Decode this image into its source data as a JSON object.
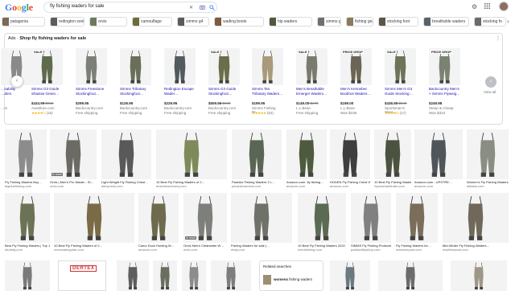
{
  "logo": {
    "letters": [
      "G",
      "o",
      "o",
      "g",
      "l",
      "e"
    ],
    "colors": [
      "#4285f4",
      "#ea4335",
      "#fbbc05",
      "#4285f4",
      "#34a853",
      "#ea4335"
    ]
  },
  "search": {
    "query": "fly fishing waders for sale",
    "close_icon": "close-icon",
    "camera_icon": "camera-icon",
    "search_icon": "search-icon"
  },
  "header_icons": [
    "gear-icon",
    "apps-grid-icon"
  ],
  "chips": [
    {
      "label": "patagonia",
      "color": "#7a6a55"
    },
    {
      "label": "redington sonic",
      "color": "#5c5c5c"
    },
    {
      "label": "orvis",
      "color": "#6b7b5a"
    },
    {
      "label": "camouflage",
      "color": "#6d6a3c"
    },
    {
      "label": "simms g4",
      "color": "#5a5a5a"
    },
    {
      "label": "wading boots",
      "color": "#7b5a3d"
    },
    {
      "label": "hip waders",
      "color": "#4e5a3a"
    },
    {
      "label": "simms g3",
      "color": "#6e6e6e"
    },
    {
      "label": "fishing gear",
      "color": "#8a7b5c"
    },
    {
      "label": "stocking foot",
      "color": "#5d5448"
    },
    {
      "label": "breathable waders",
      "color": "#57636b"
    },
    {
      "label": "stocking fo",
      "color": "#6a6a6a"
    }
  ],
  "ads": {
    "prefix": "Ads · ",
    "title": "Shop fly fishing waders for sale",
    "more_icon": "more-vert-icon",
    "view_all": "View all",
    "products": [
      {
        "badge": "",
        "name": "…sability\n…ders",
        "price": "",
        "old": "",
        "store": "…m",
        "rating": "",
        "reviews": "",
        "color": "#8a8a8a"
      },
      {
        "badge": "SALE",
        "name": "Simms G3 Guide\nShadow Green…",
        "price": "$434.99",
        "old": "$550",
        "store": "Avantlure.com",
        "rating": "★★★★½",
        "reviews": "(16)",
        "color": "#5e6b4d"
      },
      {
        "badge": "",
        "name": "Simms Freestone\nStockingfoot…",
        "price": "$299.95",
        "old": "",
        "store": "Backcountry.com",
        "rating": "",
        "reviews": "Free shipping",
        "color": "#7c7f78"
      },
      {
        "badge": "",
        "name": "Simms Tributary\nStockingfoot…",
        "price": "$126.95",
        "old": "",
        "store": "Backcountry.com",
        "rating": "",
        "reviews": "Free shipping",
        "color": "#6a6f5a"
      },
      {
        "badge": "",
        "name": "Redington Escape\nWader…",
        "price": "$229.95",
        "old": "",
        "store": "Backcountry.com",
        "rating": "",
        "reviews": "Free shipping",
        "color": "#535b5e"
      },
      {
        "badge": "SALE",
        "name": "Simms G3 Guide\nStockingfoot…",
        "price": "$509.96",
        "old": "$600",
        "store": "Backcountry.com",
        "rating": "",
        "reviews": "Free shipping",
        "color": "#6a6e4a"
      },
      {
        "badge": "",
        "name": "Simms Tan\nTributary Waders…",
        "price": "$199.95",
        "old": "",
        "store": "Simms Fishing Pr…",
        "rating": "★★★★★",
        "reviews": "(52)",
        "color": "#a99a7c"
      },
      {
        "badge": "SALE",
        "name": "Men's Breathable\nEmerger Waders…",
        "price": "$149.00",
        "old": "$179",
        "store": "L.L.Bean",
        "rating": "",
        "reviews": "Free shipping",
        "color": "#7b7a6e"
      },
      {
        "badge": "PRICE DROP",
        "name": "Men's Kennebec\nBootfoot Waders…",
        "price": "$199.00",
        "old": "",
        "store": "L.L.Bean",
        "rating": "",
        "reviews": "Was $238",
        "color": "#6b6555"
      },
      {
        "badge": "SALE",
        "name": "Simms Men's G3\nGuide Stocking…",
        "price": "$436.95",
        "old": "$549",
        "store": "Sportsman's Ware…",
        "rating": "★★★★½",
        "reviews": "(17)",
        "color": "#6c7459"
      },
      {
        "badge": "PRICE DROP",
        "name": "Backcountry Men's\n× Simms Flyweig…",
        "price": "$249.98",
        "old": "",
        "store": "Steep & Cheap",
        "rating": "",
        "reviews": "Was $323",
        "color": "#7a8272"
      }
    ]
  },
  "row1": [
    {
      "caption": "Fly Fishing Waders Buy…",
      "source": "bigbluefishing.com",
      "color": "#8c8c8c",
      "instock": ""
    },
    {
      "caption": "Orvis | Men's Pro Wader - St…",
      "source": "orvis.com",
      "color": "#6b6b64",
      "instock": "In stock"
    },
    {
      "caption": "Light Weight Fly Fishing Chest…",
      "source": "aliexpress.com",
      "color": "#595959",
      "instock": ""
    },
    {
      "caption": "10 Best Fly Fishing Waders of 2…",
      "source": "bestofmachinery.com",
      "color": "#7d8a5a",
      "instock": ""
    },
    {
      "caption": "Pautzke Fishing Waders 3 L…",
      "source": "pautzkecamera.com",
      "color": "#5a6655",
      "instock": ""
    },
    {
      "caption": "Amazon.com: fly fishing…",
      "source": "amazon.com",
      "color": "#4d5a3d",
      "instock": ""
    },
    {
      "caption": "HODEN Fly Fishing Chest Wad…",
      "source": "amazon.com",
      "color": "#3e3e3e",
      "instock": ""
    },
    {
      "caption": "10 Best Fly Fishing Waders…",
      "source": "Sportsmanfinder.com",
      "color": "#4b5340",
      "instock": ""
    },
    {
      "caption": "Amazon.com : UPSTRE…",
      "source": "amazon.com",
      "color": "#50555a",
      "instock": ""
    },
    {
      "caption": "Women's Fly Fishing Waders…",
      "source": "alibaba.com",
      "color": "#8a8d82",
      "instock": ""
    }
  ],
  "row2": [
    {
      "caption": "Best Fly Fishing Waders | Top 11…",
      "source": "shotsfly.com",
      "color": "#6b7356",
      "instock": ""
    },
    {
      "caption": "10 Best Fly Fishing Waders of 2…",
      "source": "mensnakeguide.com",
      "color": "#7a6a45",
      "instock": ""
    },
    {
      "caption": "Camo Duck Hunting W…",
      "source": "amazon.com",
      "color": "#6e6a4e",
      "instock": ""
    },
    {
      "caption": "Orvis Men's Clearwater W…",
      "source": "orvis.com",
      "color": "#7d7f7a",
      "instock": "In stock"
    },
    {
      "caption": "Fishing Waders for sale |…",
      "source": "ebay.com",
      "color": "#6f7268",
      "instock": ""
    },
    {
      "caption": "10 Best Fly Fishing Waders 2022…",
      "source": "mensfishing.com",
      "color": "#5b6a52",
      "instock": ""
    },
    {
      "caption": "SIMMS Fly Fishing Products",
      "source": "paddockflyshop.com",
      "color": "#808080",
      "instock": ""
    },
    {
      "caption": "Fly Fishing Waders for…",
      "source": "madriverpost.com",
      "color": "#7a6e5a",
      "instock": ""
    },
    {
      "caption": "Mid-Winter Fly Fishing Waders…",
      "source": "madriverpost.com",
      "color": "#70685a",
      "instock": ""
    }
  ],
  "row3": [
    {
      "color": "#7a7a7a"
    },
    {
      "color": "#5e5e5e"
    },
    {
      "color": "#6a6e5e"
    },
    {
      "color": "#8c8c8c"
    },
    {
      "color": "#7d7d7d"
    },
    {
      "color": "#6b7a7e"
    },
    {
      "color": "#6b6b6b"
    },
    {
      "color": "#9e9788"
    }
  ],
  "dertex": {
    "logo": "DERTEX"
  },
  "related": {
    "title": "Related searches",
    "query_bold": "womens",
    "query_rest": " fishing waders"
  }
}
